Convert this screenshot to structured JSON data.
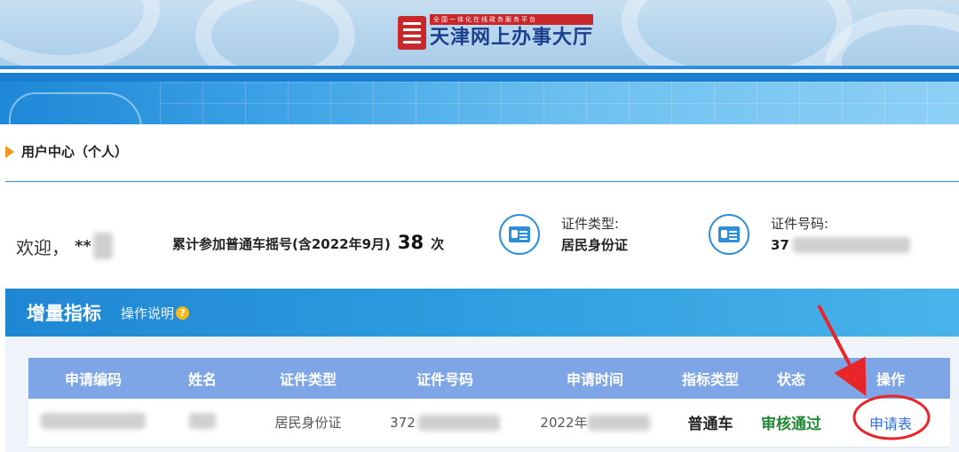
{
  "header": {
    "slogan": "全国一体化在线政务服务平台",
    "site_name": "天津网上办事大厅",
    "seal_icon": "tianjin-seal-icon"
  },
  "user_center": {
    "title": "用户中心（个人）"
  },
  "welcome": {
    "greeting": "欢迎，",
    "name_prefix": "**"
  },
  "stats": {
    "label": "累计参加普通车摇号(含2022年9月)",
    "count": "38",
    "unit": "次"
  },
  "id_type": {
    "label": "证件类型:",
    "value": "居民身份证",
    "icon": "id-card-icon"
  },
  "id_number": {
    "label": "证件号码:",
    "value_prefix": "37",
    "icon": "id-user-icon"
  },
  "panel": {
    "title": "增量指标",
    "help_label": "操作说明",
    "help_icon": "question-icon"
  },
  "table": {
    "headers": [
      "申请编码",
      "姓名",
      "证件类型",
      "证件号码",
      "申请时间",
      "指标类型",
      "状态",
      "操作"
    ],
    "row": {
      "id_type": "居民身份证",
      "id_number_prefix": "372",
      "apply_time_prefix": "2022年",
      "quota_type": "普通车",
      "status": "审核通过",
      "action": "申请表"
    }
  },
  "colors": {
    "accent_blue": "#2f8fd6",
    "status_green": "#1f8a34",
    "annotation_red": "#e8262a",
    "header_row": "#7ea6e6"
  }
}
